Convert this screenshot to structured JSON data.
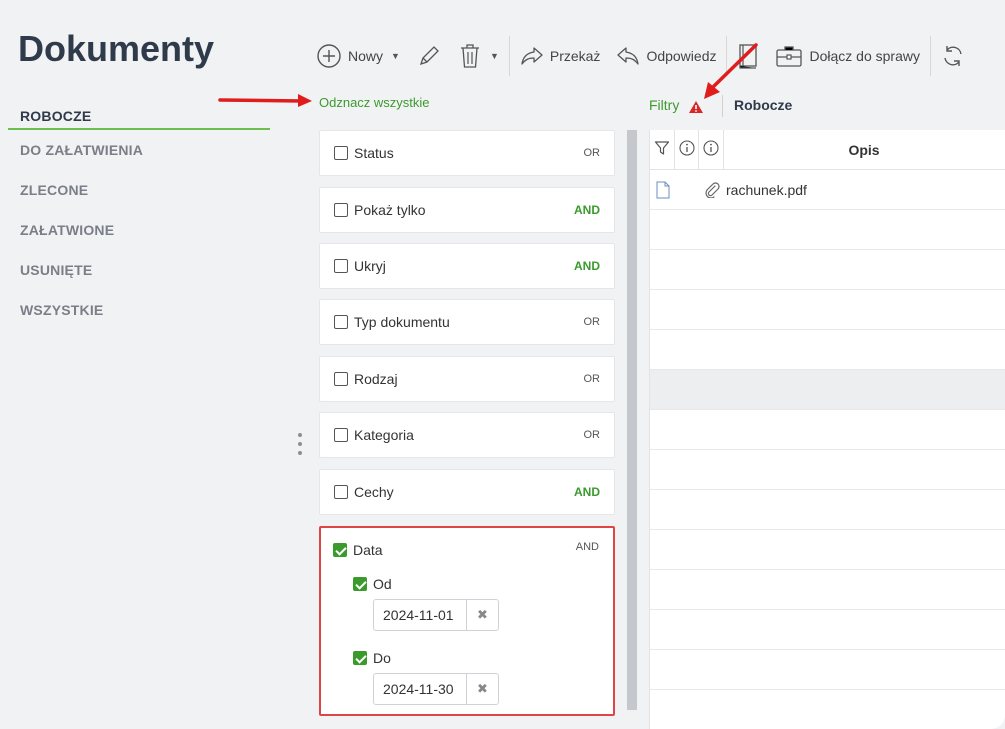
{
  "page_title": "Dokumenty",
  "toolbar": {
    "new_label": "Nowy",
    "forward_label": "Przekaż",
    "reply_label": "Odpowiedz",
    "attach_case_label": "Dołącz do sprawy"
  },
  "sidebar": {
    "items": [
      {
        "label": "ROBOCZE"
      },
      {
        "label": "DO ZAŁATWIENIA"
      },
      {
        "label": "ZLECONE"
      },
      {
        "label": "ZAŁATWIONE"
      },
      {
        "label": "USUNIĘTE"
      },
      {
        "label": "WSZYSTKIE"
      }
    ],
    "active": "ROBOCZE"
  },
  "filters": {
    "select_all_label": "Odznacz wszystkie",
    "items": [
      {
        "label": "Status",
        "op": "OR",
        "checked": false
      },
      {
        "label": "Pokaż tylko",
        "op": "AND",
        "checked": false
      },
      {
        "label": "Ukryj",
        "op": "AND",
        "checked": false
      },
      {
        "label": "Typ dokumentu",
        "op": "OR",
        "checked": false
      },
      {
        "label": "Rodzaj",
        "op": "OR",
        "checked": false
      },
      {
        "label": "Kategoria",
        "op": "OR",
        "checked": false
      },
      {
        "label": "Cechy",
        "op": "AND",
        "checked": false
      }
    ],
    "date": {
      "label": "Data",
      "op": "AND",
      "checked": true,
      "from_label": "Od",
      "from_value": "2024-11-01",
      "to_label": "Do",
      "to_value": "2024-11-30"
    }
  },
  "right_panel": {
    "filters_label": "Filtry",
    "folder_label": "Robocze",
    "column_header": "Opis",
    "rows": [
      {
        "file": "rachunek.pdf"
      }
    ]
  },
  "colors": {
    "accent_green": "#3a9a2c",
    "highlight_red": "#e04545",
    "warning_red": "#d62828"
  }
}
